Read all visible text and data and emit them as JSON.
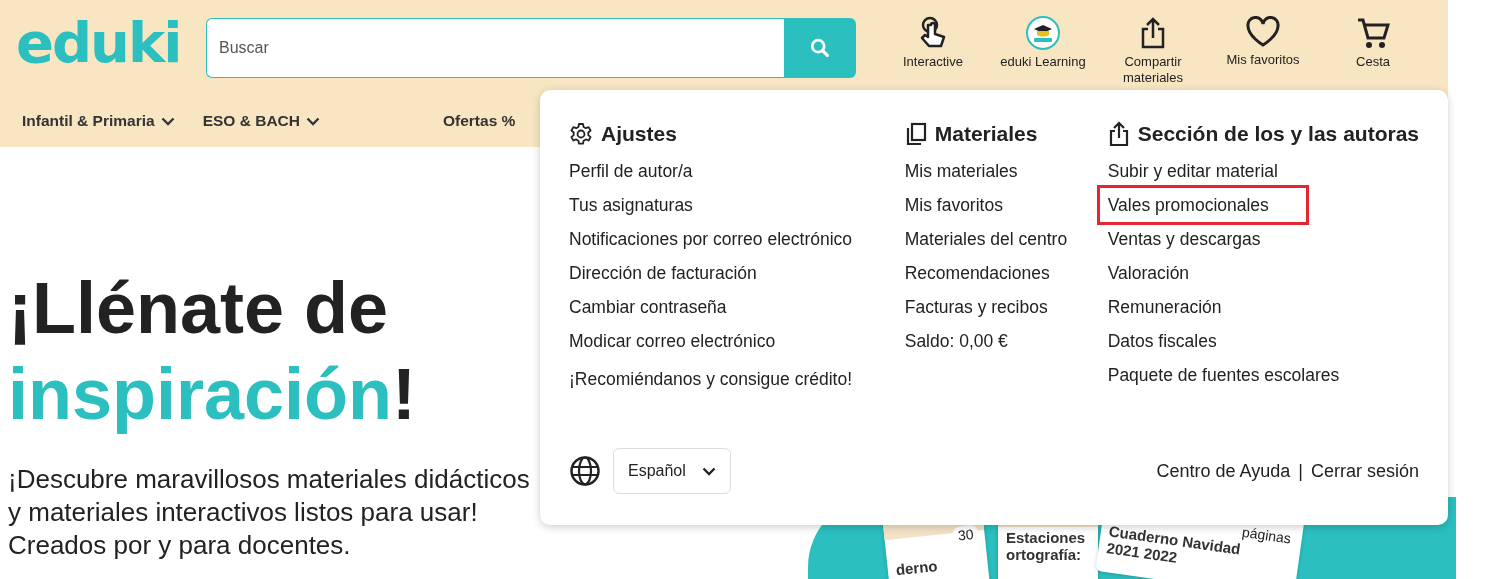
{
  "header": {
    "logo": "eduki",
    "search": {
      "placeholder": "Buscar"
    },
    "actions": [
      {
        "kind": "touch",
        "label": "Interactive"
      },
      {
        "kind": "badge",
        "label": "eduki Learning"
      },
      {
        "kind": "share",
        "label": "Compartir materiales"
      },
      {
        "kind": "heart",
        "label": "Mis favoritos"
      },
      {
        "kind": "cart",
        "label": "Cesta"
      }
    ]
  },
  "nav": [
    {
      "label": "Infantil & Primaria",
      "dropdown": true
    },
    {
      "label": "ESO & BACH",
      "dropdown": true
    },
    {
      "label": "Ofertas %",
      "dropdown": false
    }
  ],
  "hero": {
    "title_line1": "¡Llénate de",
    "title_accent": "inspiración",
    "title_end": "!",
    "subtitle": [
      "¡Descubre maravillosos materiales didácticos",
      "y materiales interactivos listos para usar!",
      "Creados por y para docentes."
    ],
    "cards": [
      {
        "badge": "30",
        "title": "derno"
      },
      {
        "title": "Estaciones ortografía:"
      },
      {
        "badge": "páginas",
        "title": "Cuaderno Navidad 2021 2022"
      }
    ]
  },
  "menu": {
    "columns": [
      {
        "kind": "gear",
        "title": "Ajustes",
        "items": [
          {
            "label": "Perfil de autor/a",
            "highlighted": false
          },
          {
            "label": "Tus asignaturas",
            "highlighted": false
          },
          {
            "label": "Notificaciones por correo electrónico",
            "highlighted": false
          },
          {
            "label": "Dirección de facturación",
            "highlighted": false
          },
          {
            "label": "Cambiar contraseña",
            "highlighted": false
          },
          {
            "label": "Modicar correo electrónico",
            "highlighted": false
          },
          {
            "label": "¡Recomiéndanos y consigue crédito!",
            "highlighted": false
          }
        ]
      },
      {
        "kind": "copy",
        "title": "Materiales",
        "items": [
          {
            "label": "Mis materiales",
            "highlighted": false
          },
          {
            "label": "Mis favoritos",
            "highlighted": false
          },
          {
            "label": "Materiales del centro",
            "highlighted": false
          },
          {
            "label": "Recomendaciones",
            "highlighted": false
          },
          {
            "label": "Facturas y recibos",
            "highlighted": false
          },
          {
            "label": "Saldo: 0,00 €",
            "highlighted": false
          }
        ]
      },
      {
        "kind": "share",
        "title": "Sección de los y las autoras",
        "items": [
          {
            "label": "Subir y editar material",
            "highlighted": false
          },
          {
            "label": "Vales promocionales",
            "highlighted": true
          },
          {
            "label": "Ventas y descargas",
            "highlighted": false
          },
          {
            "label": "Valoración",
            "highlighted": false
          },
          {
            "label": "Remuneración",
            "highlighted": false
          },
          {
            "label": "Datos fiscales",
            "highlighted": false
          },
          {
            "label": "Paquete de fuentes escolares",
            "highlighted": false
          }
        ]
      }
    ],
    "language": "Español",
    "links": [
      "Centro de Ayuda",
      "Cerrar sesión"
    ],
    "separator": "|"
  }
}
